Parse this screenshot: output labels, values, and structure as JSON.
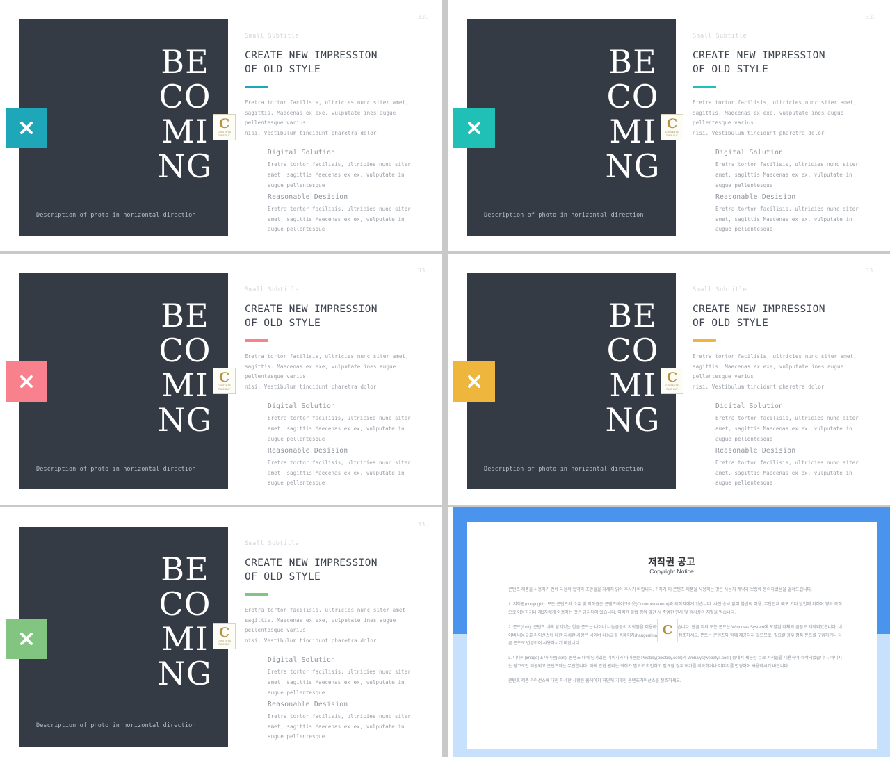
{
  "page": {
    "background_color": "#c9c9c9",
    "slide_count": 6
  },
  "slide_common": {
    "page_number": "33.",
    "subtitle": "Small Subtitle",
    "headline": "CREATE NEW IMPRESSION\nOF OLD STYLE",
    "lead": "Eretra tortor facilisis, ultricies nunc siter amet,\nsagittis. Maecenas ex exe, vulputate ines augue\npellentesque varius\nnisi. Vestibulum tincidunt pharetra dolor",
    "sub_heading_1": "Digital Solution",
    "sub_paragraph_1": "Eretra tortor facilisis, ultricies nunc siter\namet, sagittis Maecenas ex ex, vulputate in\naugue pellentesque",
    "sub_heading_2": "Reasonable Desision",
    "sub_paragraph_2": "Eretra tortor facilisis, ultricies nunc siter\namet, sagittis Maecenas ex ex, vulputate in\naugue pellentesque",
    "big_word": "BE\nCO\nMI\nNG",
    "photo_description": "Description of\nphoto in horizontal\ndirection",
    "logo_letter": "C",
    "logo_caption_1": "CONTENTS",
    "logo_caption_2": "TAKE OUT",
    "photo_color": "#353b45"
  },
  "slides": [
    {
      "id": 1,
      "accent_color": "#1ea7b9",
      "badge_icon": "close-x-icon"
    },
    {
      "id": 2,
      "accent_color": "#20c0b6",
      "badge_icon": "close-x-icon"
    },
    {
      "id": 3,
      "accent_color": "#f9808d",
      "badge_icon": "close-x-icon"
    },
    {
      "id": 4,
      "accent_color": "#eeb63c",
      "badge_icon": "close-x-icon"
    },
    {
      "id": 5,
      "accent_color": "#82c580",
      "badge_icon": "close-x-icon"
    }
  ],
  "copyright_slide": {
    "frame_color_top": "#4a94ee",
    "frame_color_bottom": "#c7e0fb",
    "title": "저작권 공고",
    "subtitle": "Copyright Notice",
    "logo_letter": "C",
    "paragraphs": [
      "콘텐츠 제품을 사용하기 전에 다음의 협약과 조항들을 자세히 읽어 주시기 바랍니다. 귀하가 이 콘텐츠 제품을 사용하는 것은 사용자 계약과 보증에 동의하셨음을 알려드립니다.",
      "1. 저작권(copyright): 모든 콘텐츠의 소유 및 저작권은 콘텐츠테이크아웃(Contentstakeout)과 제작자에게 있습니다. 사전 승낙 없이 불법적 이용, 무단전재 배포 기타 방법에 의하여 영리 목적으로 이용하거나 제3자에게 이용하는 것은 금지되어 있습니다. 이러한 불법 행위 발견 시 준엄한 민사 및 형사상의 처벌을 받습니다.",
      "2. 폰트(font): 콘텐츠 내에 담겨있는 한글 폰트는 네이버 나눔글꼴의 저작물을 이용하여 제작되었습니다. 한글 외의 모든 폰트는 Windows System에 포함된 자체의 글꼴로 제작되었습니다. 네이버 나눔글꼴 라이선스에 대한 자세한 사항은 네이버 나눔글꼴 홈페이지(hangeul.naver.com)를 참조하세요. 폰트는 콘텐츠와 함께 제공되지 않으므로, 필요할 경우 정품 폰트를 구입하거나 다른 폰트로 변경하여 사용하시기 바랍니다.",
      "3. 이미지(image) & 아이콘(icon): 콘텐츠 내에 담겨있는 이미지와 아이콘은 Pixabay(pixabay.com)와 Webalys(webalys.com) 등에서 제공한 무료 저작물을 이용하여 제작되었습니다. 이미지는 참고로만 제공되고 콘텐츠와는 무관합니다. 이에 관한 권리는 귀하가 별도로 확인하고 필요할 경우 허가를 취득하거나 이미지를 변경하여 사용하시기 바랍니다.",
      "콘텐츠 제품 라이선스에 대한 자세한 사항은 홈페이지 하단에 기재한 콘텐츠라이선스를 참조하세요."
    ]
  }
}
